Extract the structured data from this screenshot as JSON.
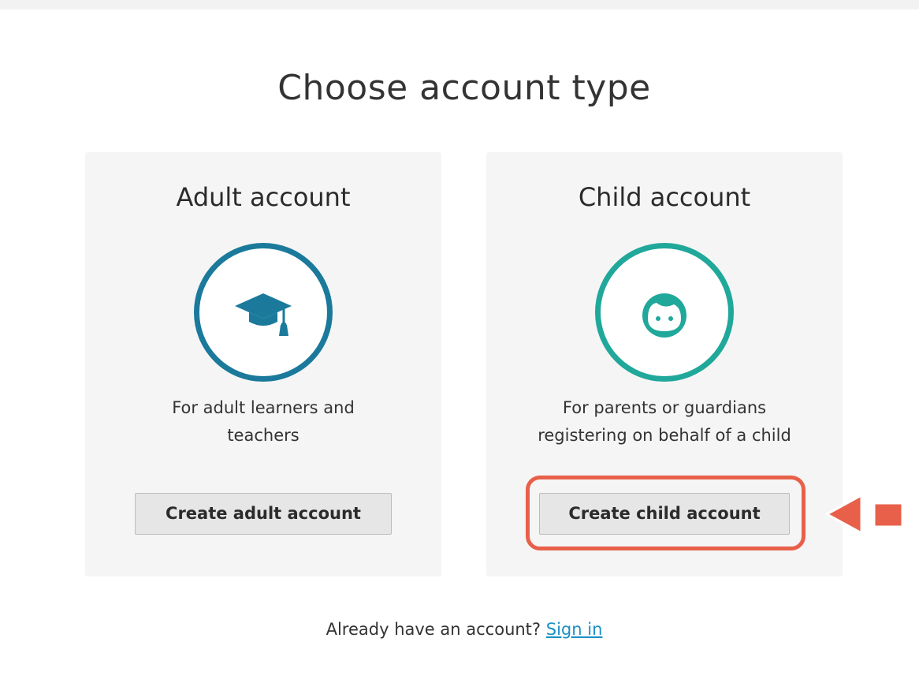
{
  "page": {
    "title": "Choose account type"
  },
  "cards": {
    "adult": {
      "title": "Adult account",
      "icon": "graduation-cap-icon",
      "desc_line1": "For adult learners and",
      "desc_line2": "teachers",
      "button": "Create adult account",
      "accent": "#1b7a9b"
    },
    "child": {
      "title": "Child account",
      "icon": "child-face-icon",
      "desc_line1": "For parents or guardians",
      "desc_line2": "registering on behalf of a child",
      "button": "Create child account",
      "accent": "#20a89a"
    }
  },
  "footer": {
    "prompt": "Already have an account?",
    "link": "Sign in"
  },
  "annotation": {
    "highlight_color": "#e8604a",
    "arrow_icon": "left-arrow-icon"
  }
}
